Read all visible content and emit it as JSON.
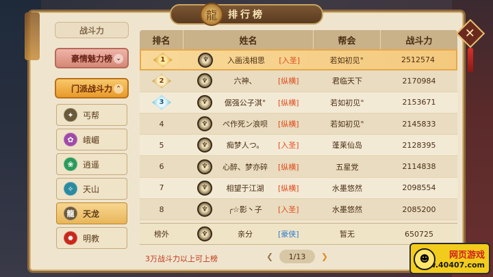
{
  "title": "排行榜",
  "sidebar": {
    "partial_label": "战斗力",
    "categories": [
      {
        "label": "豪情魅力榜"
      },
      {
        "label": "门派战斗力"
      }
    ],
    "schools": [
      {
        "label": "丐帮",
        "icon": "beggar-icon",
        "color": "#6a5a3a"
      },
      {
        "label": "峨嵋",
        "icon": "emei-icon",
        "color": "#a04aa8"
      },
      {
        "label": "逍遥",
        "icon": "xiaoyao-icon",
        "color": "#2a9a5a"
      },
      {
        "label": "天山",
        "icon": "tianshan-icon",
        "color": "#2a8aa0"
      },
      {
        "label": "天龙",
        "icon": "tianlong-icon",
        "color": "#6a5a3a"
      },
      {
        "label": "明教",
        "icon": "mingjiao-icon",
        "color": "#c8281a"
      }
    ],
    "active_school": "天龙"
  },
  "table": {
    "headers": {
      "rank": "排名",
      "name": "姓名",
      "guild": "帮会",
      "power": "战斗力"
    },
    "rows": [
      {
        "rank": "1",
        "name": "入画浅相思",
        "faction": "[入圣]",
        "faction_type": "red",
        "guild": "若如初见°",
        "power": "2512574"
      },
      {
        "rank": "2",
        "name": "六神、",
        "faction": "[纵横]",
        "faction_type": "red",
        "guild": "君临天下",
        "power": "2170984"
      },
      {
        "rank": "3",
        "name": "倨强公子淇°",
        "faction": "[纵横]",
        "faction_type": "red",
        "guild": "若如初见°",
        "power": "2153671"
      },
      {
        "rank": "4",
        "name": "ぺ作死ン浪呗",
        "faction": "[纵横]",
        "faction_type": "red",
        "guild": "若如初见°",
        "power": "2145833"
      },
      {
        "rank": "5",
        "name": "痴梦人つ。",
        "faction": "[入圣]",
        "faction_type": "red",
        "guild": "蓬莱仙岛",
        "power": "2128395"
      },
      {
        "rank": "6",
        "name": "心醉、梦亦碎",
        "faction": "[纵横]",
        "faction_type": "red",
        "guild": "五星党",
        "power": "2114838"
      },
      {
        "rank": "7",
        "name": "相望于江湖",
        "faction": "[纵横]",
        "faction_type": "red",
        "guild": "水墨悠然",
        "power": "2098554"
      },
      {
        "rank": "8",
        "name": "╭☆影丶子",
        "faction": "[入圣]",
        "faction_type": "red",
        "guild": "水墨悠然",
        "power": "2085200"
      }
    ],
    "self_row": {
      "rank": "榜外",
      "name": "亲分",
      "faction": "[豪侠]",
      "faction_type": "blue",
      "guild": "暂无",
      "power": "650725"
    }
  },
  "footer": {
    "note": "3万战斗力以上可上榜",
    "page": "1/13",
    "prev_icon": "chevron-left-icon",
    "next_icon": "chevron-right-icon"
  },
  "watermark": {
    "top": "网页游戏",
    "bottom": "www.40407.com"
  }
}
